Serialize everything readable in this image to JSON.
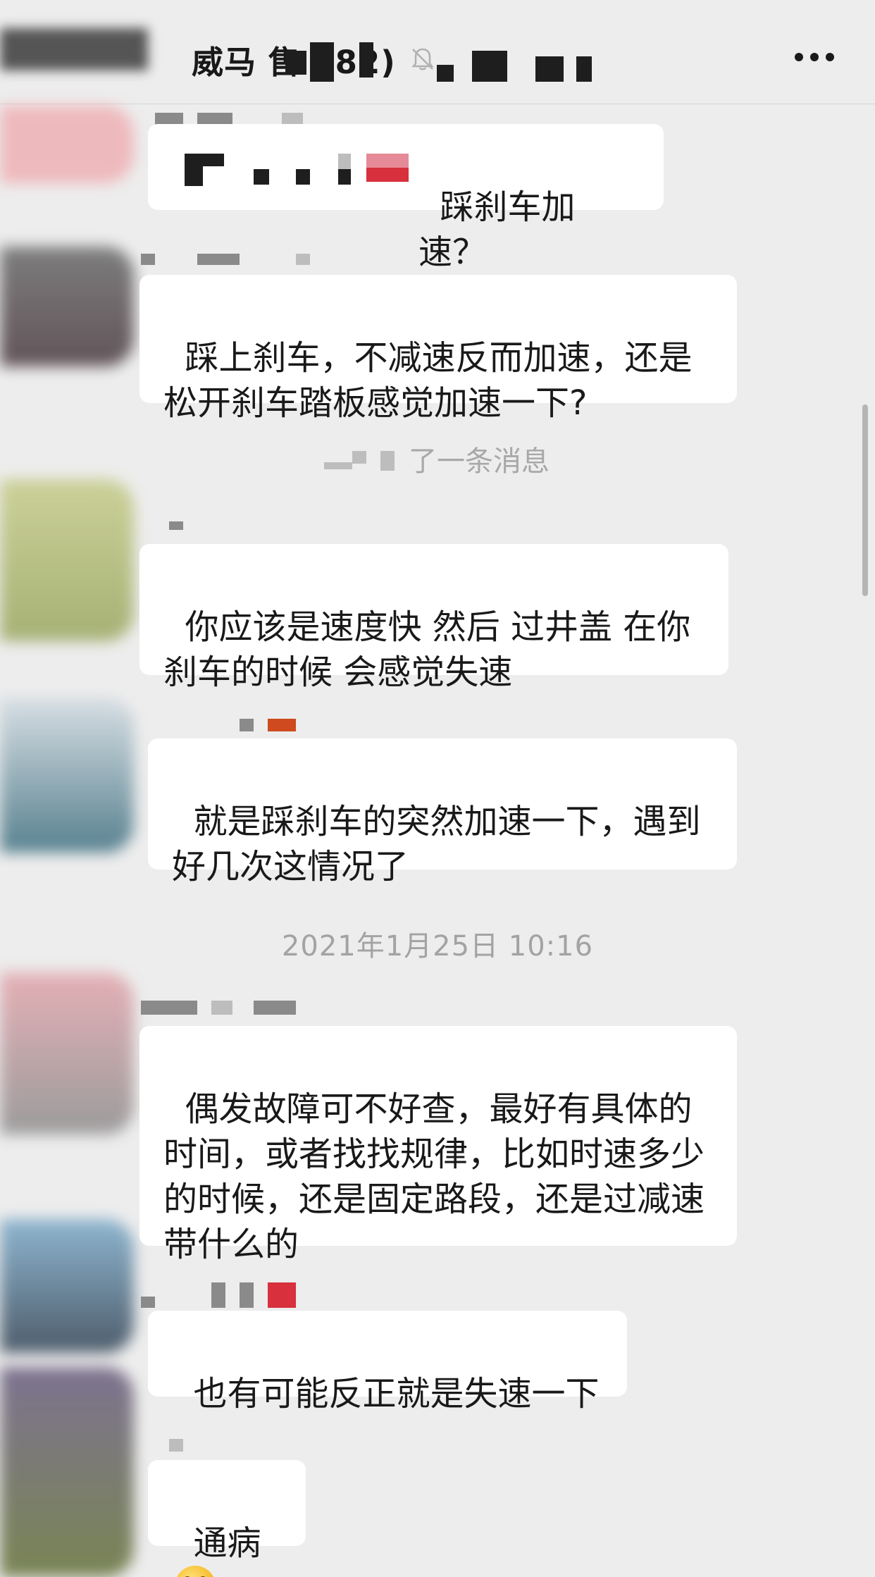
{
  "header": {
    "title": "威马 售 282)",
    "muted_icon": "bell-off-icon",
    "more_icon": "more-dots-icon"
  },
  "messages": [
    {
      "text": "踩刹车加速？"
    },
    {
      "text": "踩上刹车，不减速反而加速，还是松开刹车踏板感觉加速一下?"
    },
    {
      "text": "你应该是速度快 然后 过井盖 在你刹车的时候 会感觉失速"
    },
    {
      "text": "就是踩刹车的突然加速一下，遇到好几次这情况了"
    },
    {
      "text": "偶发故障可不好查，最好有具体的时间，或者找找规律，比如时速多少的时候，还是固定路段，还是过减速带什么的"
    },
    {
      "text": "也有可能反正就是失速一下"
    },
    {
      "text": "通病",
      "emoji": "grinning-face-icon"
    }
  ],
  "system_message": "了一条消息",
  "timestamp": "2021年1月25日 10:16"
}
